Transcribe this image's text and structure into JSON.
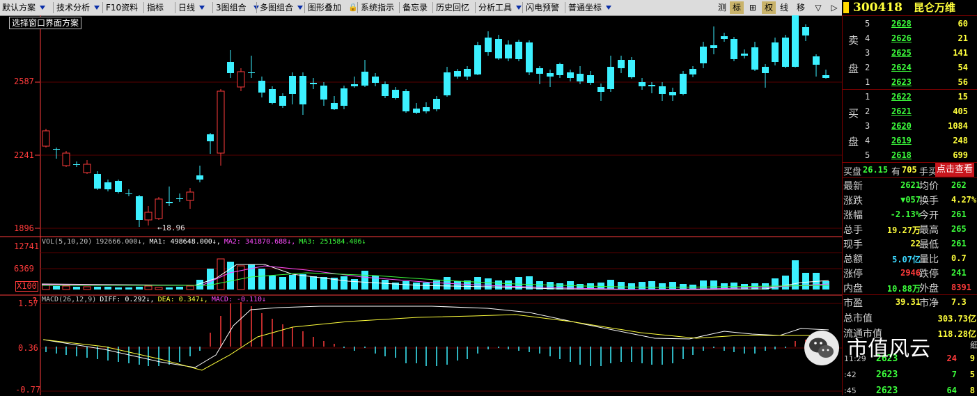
{
  "toolbar": {
    "items": [
      {
        "label": "默认方案",
        "menu": true
      },
      {
        "label": "技术分析",
        "menu": true
      },
      {
        "label": "F10资料",
        "menu": false
      },
      {
        "label": "指标",
        "menu": false
      },
      {
        "label": "日线",
        "menu": true
      },
      {
        "label": "3图组合",
        "menu": true
      },
      {
        "label": "多图组合",
        "menu": true
      },
      {
        "label": "图形叠加",
        "menu": false
      },
      {
        "label": "系统指示",
        "menu": false
      },
      {
        "label": "备忘录",
        "menu": false
      },
      {
        "label": "历史回忆",
        "menu": false
      },
      {
        "label": "分析工具",
        "menu": true
      },
      {
        "label": "闪电预警",
        "menu": false
      },
      {
        "label": "普通坐标",
        "menu": true
      }
    ],
    "right_buttons": [
      "测",
      "标",
      "⊞",
      "权",
      "线",
      "移",
      "▽",
      "▷"
    ],
    "active_buttons": [
      "标",
      "权"
    ]
  },
  "stock": {
    "code": "300418",
    "name": "昆仑万维"
  },
  "price_chart": {
    "scheme_label": "选择窗口界面方案",
    "y_labels": [
      "2587",
      "2241",
      "1896"
    ],
    "low_marker": "18.96"
  },
  "volume_panel": {
    "y_labels": [
      "12741",
      "6369",
      "X100"
    ],
    "legend": [
      {
        "text": "VOL(5,10,20)",
        "color": "#c0c0c0"
      },
      {
        "text": "192666.000↓,",
        "color": "#c0c0c0"
      },
      {
        "text": "MA1: 498648.000↓,",
        "color": "#ffffff"
      },
      {
        "text": "MA2: 341870.688↓,",
        "color": "#ff4cff"
      },
      {
        "text": "MA3: 251584.406↓",
        "color": "#3cff3c"
      }
    ]
  },
  "macd_panel": {
    "y_labels": [
      "1.57",
      "0.36",
      "-0.77"
    ],
    "question": "?",
    "legend": [
      {
        "text": "MACD(26,12,9)",
        "color": "#c0c0c0"
      },
      {
        "text": "DIFF: 0.292↓,",
        "color": "#ffffff"
      },
      {
        "text": "DEA: 0.347↓,",
        "color": "#ffff3c"
      },
      {
        "text": "MACD: -0.110↓",
        "color": "#ff4cff"
      }
    ]
  },
  "order_book": {
    "sell_label": [
      "卖",
      "盘"
    ],
    "buy_label": [
      "买",
      "盘"
    ],
    "sell": [
      {
        "level": "5",
        "price": "2628",
        "vol": "60"
      },
      {
        "level": "4",
        "price": "2626",
        "vol": "21"
      },
      {
        "level": "3",
        "price": "2625",
        "vol": "141"
      },
      {
        "level": "2",
        "price": "2624",
        "vol": "54"
      },
      {
        "level": "1",
        "price": "2623",
        "vol": "56"
      }
    ],
    "buy": [
      {
        "level": "1",
        "price": "2622",
        "vol": "15"
      },
      {
        "level": "2",
        "price": "2621",
        "vol": "405"
      },
      {
        "level": "3",
        "price": "2620",
        "vol": "1084"
      },
      {
        "level": "4",
        "price": "2619",
        "vol": "248"
      },
      {
        "level": "5",
        "price": "2618",
        "vol": "699"
      }
    ]
  },
  "notice": {
    "prefix": "买盘",
    "price": "26.15",
    "mid": "有",
    "vol": "705",
    "suffix": "手买",
    "link": "点击查看"
  },
  "stats": [
    {
      "l1": "最新",
      "v1": "2621",
      "c1": "#3cff3c",
      "l2": "均价",
      "v2": "262",
      "c2": "#3cff3c"
    },
    {
      "l1": "涨跌",
      "v1": "▼057",
      "c1": "#3cff3c",
      "l2": "换手",
      "v2": "4.27%",
      "c2": "#ffff3c"
    },
    {
      "l1": "涨幅",
      "v1": "-2.13%",
      "c1": "#3cff3c",
      "l2": "今开",
      "v2": "261",
      "c2": "#3cff3c"
    },
    {
      "l1": "总手",
      "v1": "19.27万",
      "c1": "#ffff3c",
      "l2": "最高",
      "v2": "265",
      "c2": "#3cff3c"
    },
    {
      "l1": "现手",
      "v1": "22",
      "c1": "#ffff3c",
      "l2": "最低",
      "v2": "261",
      "c2": "#3cff3c"
    },
    {
      "l1": "总额",
      "v1": "5.07亿",
      "c1": "#3cd8ff",
      "l2": "量比",
      "v2": "0.7",
      "c2": "#ffff3c"
    },
    {
      "l1": "涨停",
      "v1": "2946",
      "c1": "#ff3b3b",
      "l2": "跌停",
      "v2": "241",
      "c2": "#3cff3c"
    },
    {
      "l1": "内盘",
      "v1": "10.88万",
      "c1": "#3cff3c",
      "l2": "外盘",
      "v2": "8391",
      "c2": "#ff3b3b"
    }
  ],
  "fundamentals": [
    {
      "l1": "市盈",
      "v1": "39.31",
      "l2": "市净",
      "v2": "7.3"
    },
    {
      "l1": "总市值",
      "v1": "303.73亿"
    },
    {
      "l1": "流通市值",
      "v1": "118.28亿"
    }
  ],
  "ticks": [
    {
      "time": "11:29",
      "price": "2623",
      "vol": "24",
      "n": "9",
      "pc": "#3cff3c",
      "vc": "#ff3b3b"
    },
    {
      "time": ":42",
      "price": "2623",
      "vol": "7",
      "n": "5",
      "pc": "#3cff3c",
      "vc": "#3cff3c"
    },
    {
      "time": ":45",
      "price": "2623",
      "vol": "64",
      "n": "8",
      "pc": "#3cff3c",
      "vc": "#3cff3c"
    }
  ],
  "ticks_header": "细",
  "watermark": "市值风云"
}
